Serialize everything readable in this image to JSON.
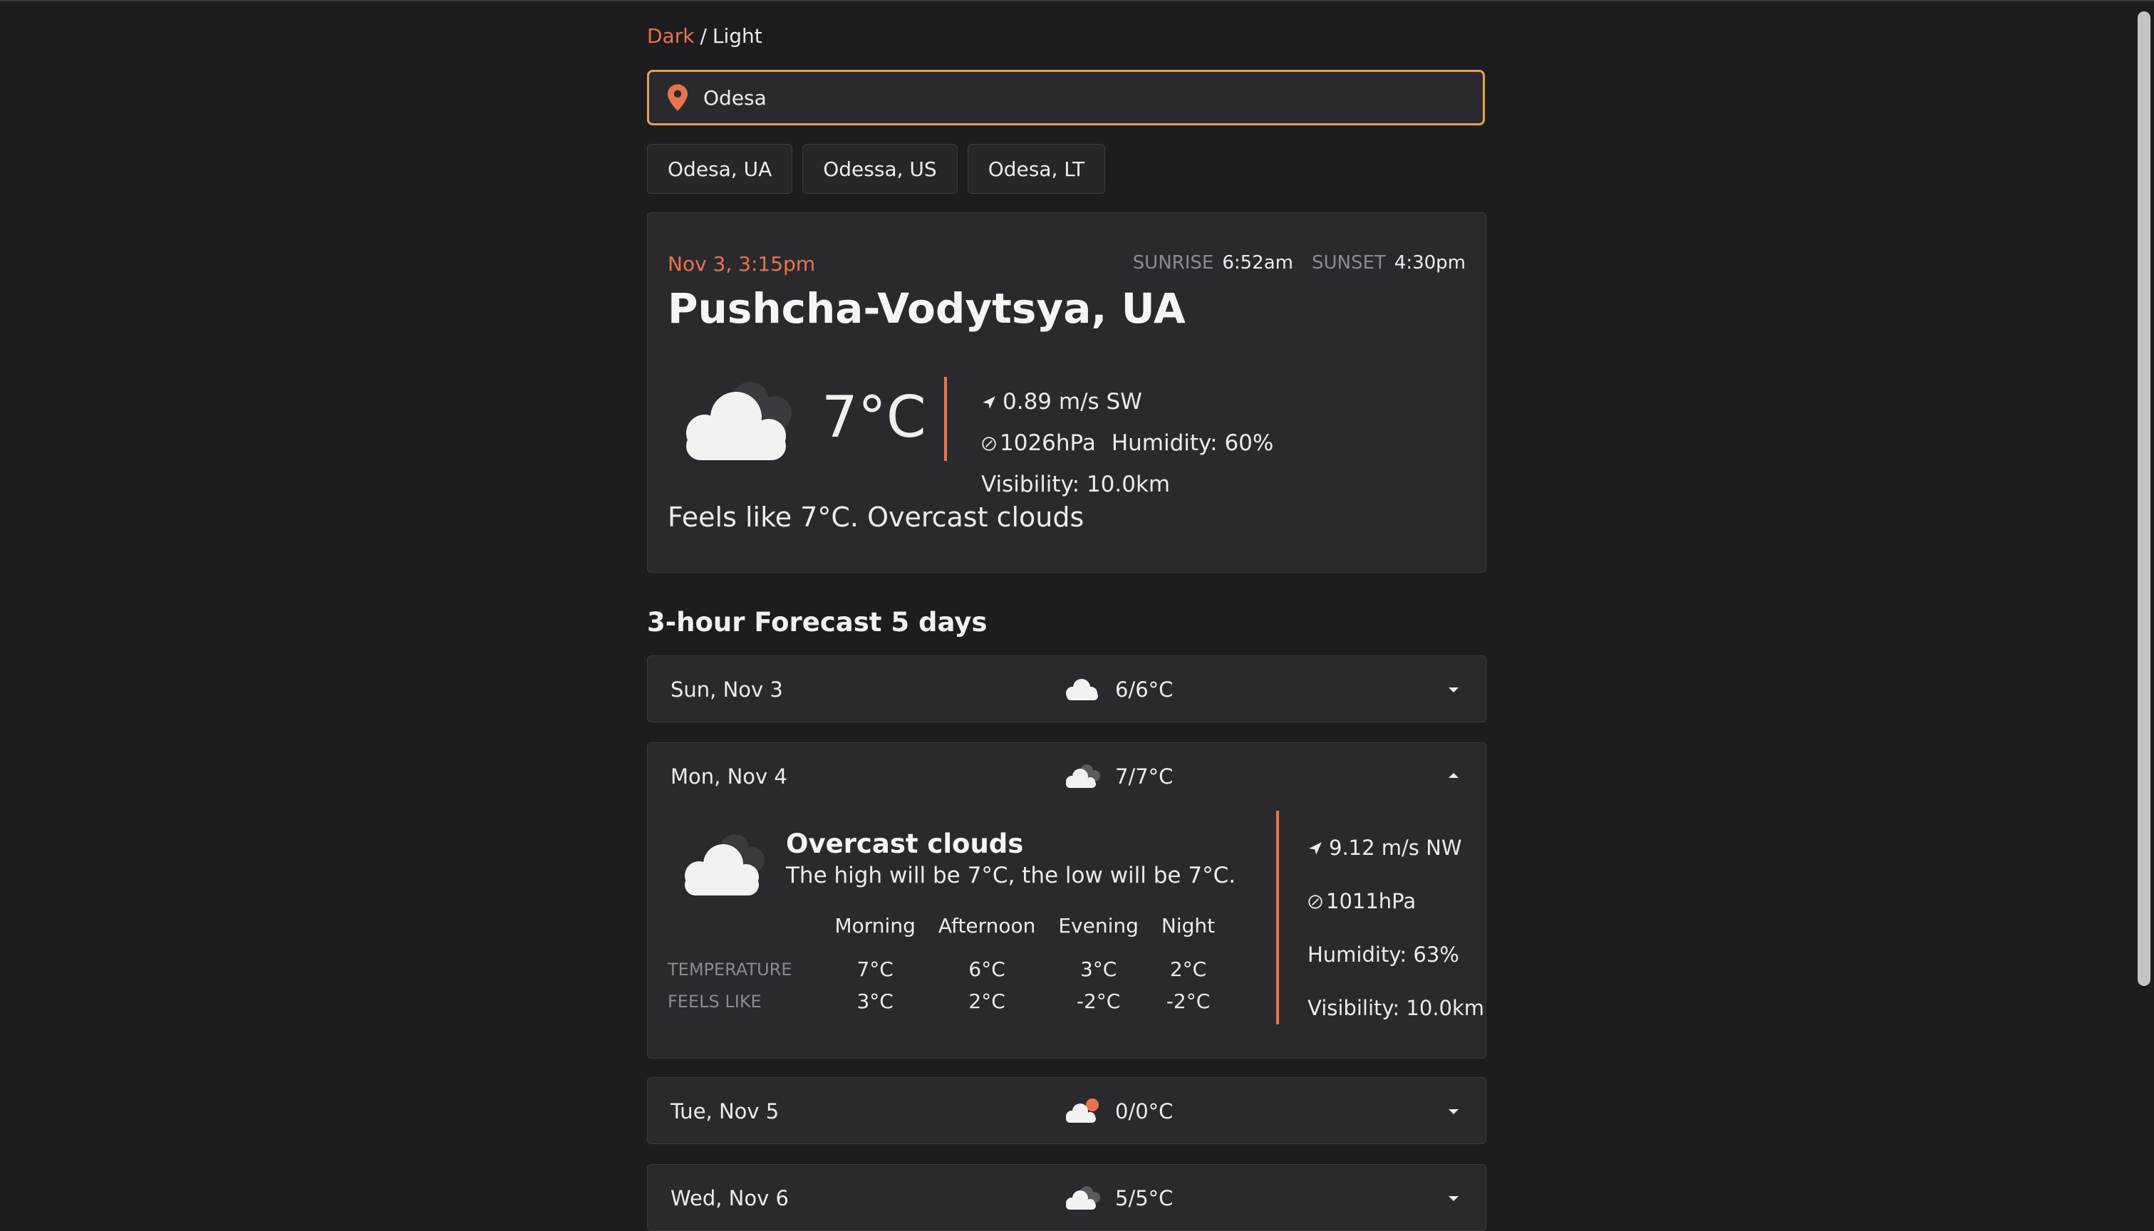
{
  "theme": {
    "dark": "Dark",
    "separator": "/",
    "light": "Light"
  },
  "search": {
    "value": "Odesa",
    "placeholder": ""
  },
  "suggestions": [
    "Odesa, UA",
    "Odessa, US",
    "Odesa, LT"
  ],
  "current": {
    "date": "Nov 3, 3:15pm",
    "sunrise_label": "SUNRISE",
    "sunrise": "6:52am",
    "sunset_label": "SUNSET",
    "sunset": "4:30pm",
    "city": "Pushcha-Vodytsya, UA",
    "icon": "overcast-clouds-icon",
    "temperature": "7°C",
    "wind": "0.89 m/s SW",
    "pressure": "1026hPa",
    "humidity": "Humidity: 60%",
    "visibility": "Visibility: 10.0km",
    "feels": "Feels like 7°C. Overcast clouds"
  },
  "forecast": {
    "title": "3-hour Forecast 5 days",
    "days": [
      {
        "name": "Sun, Nov 3",
        "range": "6/6°C",
        "icon": "cloud-icon",
        "expanded": false
      },
      {
        "name": "Mon, Nov 4",
        "range": "7/7°C",
        "icon": "overcast-clouds-icon",
        "expanded": true
      },
      {
        "name": "Tue, Nov 5",
        "range": "0/0°C",
        "icon": "cloud-sun-icon",
        "expanded": false
      },
      {
        "name": "Wed, Nov 6",
        "range": "5/5°C",
        "icon": "overcast-clouds-icon",
        "expanded": false
      }
    ],
    "expanded": {
      "title": "Overcast clouds",
      "summary": "The high will be 7°C, the low will be 7°C.",
      "periods": [
        "Morning",
        "Afternoon",
        "Evening",
        "Night"
      ],
      "rows": [
        {
          "label": "TEMPERATURE",
          "values": [
            "7°C",
            "6°C",
            "3°C",
            "2°C"
          ]
        },
        {
          "label": "FEELS LIKE",
          "values": [
            "3°C",
            "2°C",
            "-2°C",
            "-2°C"
          ]
        }
      ],
      "wind": "9.12 m/s NW",
      "pressure": "1011hPa",
      "humidity": "Humidity: 63%",
      "visibility": "Visibility: 10.0km"
    }
  },
  "colors": {
    "accent": "#e8744f",
    "focus": "#e8a24c",
    "background": "#1d1d20",
    "card": "#2a2a2e"
  }
}
